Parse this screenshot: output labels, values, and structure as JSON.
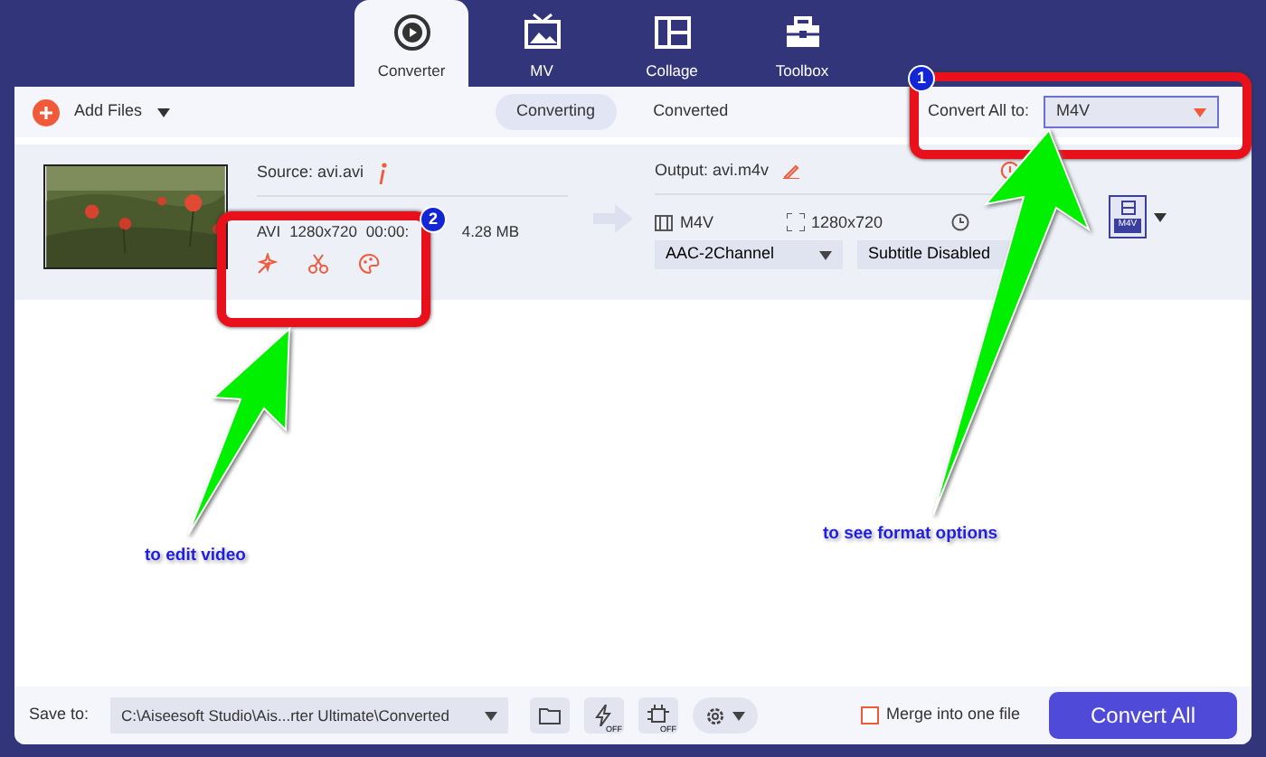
{
  "tabs": [
    {
      "label": "Converter",
      "selected": true
    },
    {
      "label": "MV",
      "selected": false
    },
    {
      "label": "Collage",
      "selected": false
    },
    {
      "label": "Toolbox",
      "selected": false
    }
  ],
  "toolbar": {
    "add_files": "Add Files",
    "views": [
      {
        "label": "Converting",
        "selected": true
      },
      {
        "label": "Converted",
        "selected": false
      }
    ],
    "convert_all_label": "Convert All to:",
    "format": "M4V"
  },
  "file": {
    "source": "Source: avi.avi",
    "source_info": [
      "AVI",
      "1280x720",
      "00:00:",
      "4.28 MB"
    ],
    "output": "Output: avi.m4v",
    "output_format": "M4V",
    "resolution": "1280x720",
    "audio": "AAC-2Channel",
    "subtitle": "Subtitle Disabled",
    "format_badge": "M4V"
  },
  "bottom": {
    "save_to": "Save to:",
    "path": "C:\\Aiseesoft Studio\\Ais...rter Ultimate\\Converted",
    "speed_off": "OFF",
    "hw_off": "OFF",
    "merge_label": "Merge into one file",
    "merge_checked": false,
    "convert_button": "Convert All"
  },
  "annotations": [
    {
      "number": "1",
      "caption": "to see format options"
    },
    {
      "number": "2",
      "caption": "to edit video"
    }
  ]
}
